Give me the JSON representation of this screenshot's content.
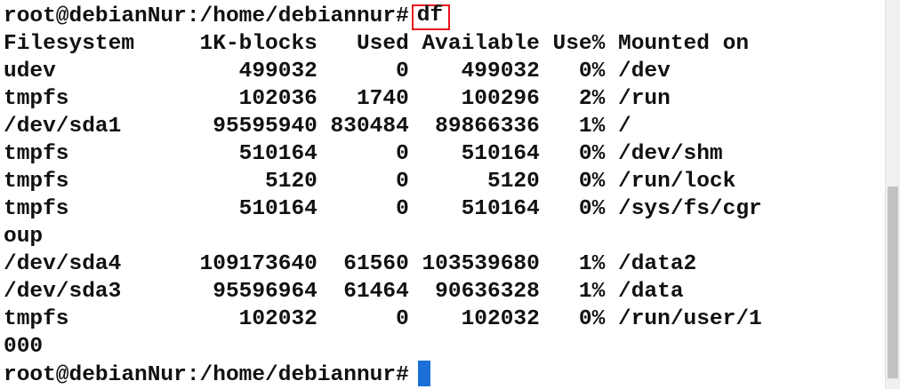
{
  "terminal": {
    "prompt": "root@debianNur:/home/debiannur#",
    "command": "df",
    "header": "Filesystem     1K-blocks   Used Available Use% Mounted on",
    "rows": [
      "udev              499032      0    499032   0% /dev",
      "tmpfs             102036   1740    100296   2% /run",
      "/dev/sda1       95595940 830484  89866336   1% /",
      "tmpfs             510164      0    510164   0% /dev/shm",
      "tmpfs               5120      0      5120   0% /run/lock",
      "tmpfs             510164      0    510164   0% /sys/fs/cgr",
      "oup",
      "/dev/sda4      109173640  61560 103539680   1% /data2",
      "/dev/sda3       95596964  61464  90636328   1% /data",
      "tmpfs             102032      0    102032   0% /run/user/1",
      "000"
    ],
    "final_prompt": "root@debianNur:/home/debiannur#"
  },
  "colors": {
    "highlight_box": "#e8141c",
    "cursor": "#1b6fd6",
    "text": "#111111"
  },
  "scrollbar": {
    "thumb_position_fraction": 0.48
  }
}
